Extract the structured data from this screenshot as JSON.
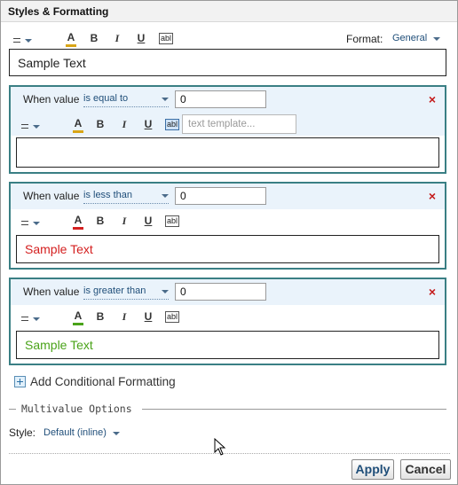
{
  "dialog": {
    "title": "Styles & Formatting"
  },
  "default_style": {
    "toolbar": {
      "bold": "B",
      "italic": "I",
      "underline": "U",
      "font_color_glyph": "A",
      "text_template_glyph": "abl",
      "font_color": "#d9a516"
    },
    "format_label": "Format:",
    "format_value": "General",
    "sample_text": "Sample Text",
    "sample_color": "#222222"
  },
  "conditions": [
    {
      "when_label": "When value",
      "operator": "is equal to",
      "value": "0",
      "font_color": "#d9a516",
      "template_placeholder": "text template...",
      "sample_text": "",
      "sample_color": "#222222"
    },
    {
      "when_label": "When value",
      "operator": "is less than",
      "value": "0",
      "font_color": "#d42020",
      "sample_text": "Sample Text",
      "sample_color": "#d42020"
    },
    {
      "when_label": "When value",
      "operator": "is greater than",
      "value": "0",
      "font_color": "#4aa319",
      "sample_text": "Sample Text",
      "sample_color": "#4aa319"
    }
  ],
  "close_glyph": "×",
  "add_conditional": "Add Conditional Formatting",
  "multivalue": {
    "legend": "Multivalue Options",
    "style_label": "Style:",
    "style_value": "Default (inline)"
  },
  "buttons": {
    "apply": "Apply",
    "cancel": "Cancel"
  },
  "colors": {
    "accent_border": "#3a7f84",
    "condition_header_bg": "#eaf3fb",
    "link_blue": "#1f4e79",
    "close_red": "#c41a1a"
  }
}
